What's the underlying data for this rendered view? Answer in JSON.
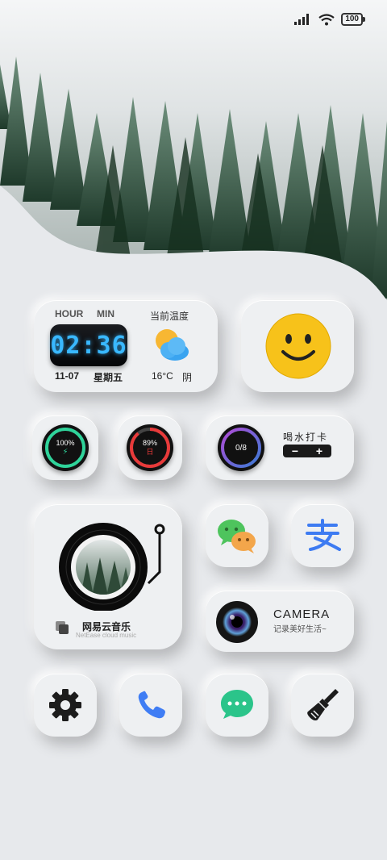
{
  "status_bar": {
    "battery_level": "100",
    "icons": [
      "signal-icon",
      "wifi-icon",
      "battery-icon"
    ]
  },
  "clock_widget": {
    "hour_label": "HOUR",
    "min_label": "MIN",
    "time": "02:36",
    "date": "11-07",
    "weekday": "星期五",
    "temp_title": "当前温度",
    "temperature": "16°C",
    "condition": "阴",
    "weather_icon": "partly-cloudy-icon"
  },
  "emoji_widget": {
    "icon": "smiley-face-icon"
  },
  "battery_widget": {
    "value": "100%"
  },
  "day_progress_widget": {
    "value": "89%",
    "unit": "日",
    "progress": 0.89
  },
  "water_widget": {
    "count": "0/8",
    "title": "喝水打卡",
    "minus_label": "−",
    "plus_label": "+"
  },
  "music_widget": {
    "title": "网易云音乐",
    "subtitle": "NetEase cloud music"
  },
  "apps": [
    {
      "id": "wechat",
      "icon": "wechat-icon"
    },
    {
      "id": "alipay",
      "icon": "alipay-icon"
    },
    {
      "id": "settings",
      "icon": "gear-icon"
    },
    {
      "id": "phone",
      "icon": "phone-icon"
    },
    {
      "id": "messages",
      "icon": "message-icon"
    },
    {
      "id": "theme",
      "icon": "brush-icon"
    }
  ],
  "camera_widget": {
    "title": "CAMERA",
    "subtitle": "记录美好生活~"
  },
  "colors": {
    "background": "#e7e9ec",
    "tile": "#eef0f2",
    "clock_digits": "#39b8ff",
    "battery_accent": "#2fd39a",
    "day_accent": "#e83a3a",
    "water_accent": "#7a3bd8",
    "alipay_blue": "#3d7bf2",
    "phone_blue": "#3f7df4",
    "message_green": "#2bc48a"
  }
}
